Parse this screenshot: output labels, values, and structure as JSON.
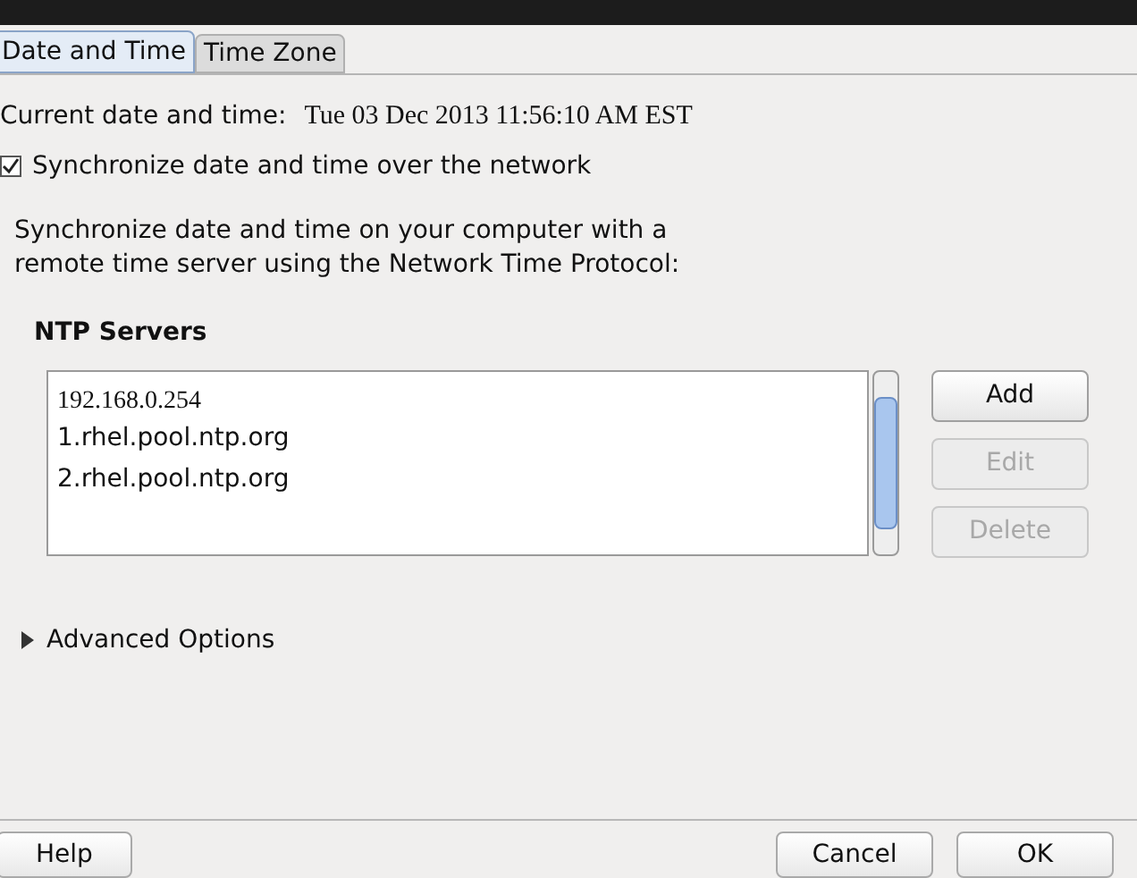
{
  "tabs": [
    {
      "label": "Date and Time",
      "selected": true
    },
    {
      "label": "Time Zone",
      "selected": false
    }
  ],
  "current": {
    "label": "Current date and time:",
    "value": "Tue 03 Dec 2013 11:56:10 AM EST"
  },
  "sync": {
    "label": "Synchronize date and time over the network",
    "checked": true
  },
  "description": "Synchronize date and time on your computer with a remote time server using the Network Time Protocol:",
  "ntp": {
    "heading": "NTP Servers",
    "servers": [
      {
        "text": "192.168.0.254",
        "kind": "serif"
      },
      {
        "text": "1.rhel.pool.ntp.org",
        "kind": "sans"
      },
      {
        "text": "2.rhel.pool.ntp.org",
        "kind": "sans"
      }
    ],
    "buttons": [
      {
        "label": "Add",
        "disabled": false
      },
      {
        "label": "Edit",
        "disabled": true
      },
      {
        "label": "Delete",
        "disabled": true
      }
    ]
  },
  "advanced": {
    "label": "Advanced Options",
    "expanded": false
  },
  "footer": {
    "left": [
      "Help"
    ],
    "right": [
      "Cancel",
      "OK"
    ]
  }
}
